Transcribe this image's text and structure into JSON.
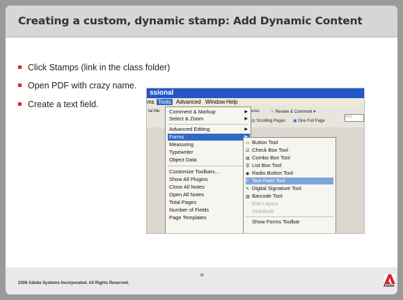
{
  "slide": {
    "title": "Creating a custom, dynamic stamp: Add Dynamic Content",
    "bullets": [
      "Click Stamps  (link in the class folder)",
      "Open PDF with crazy name.",
      "Create a text field."
    ],
    "footer": "2006 Adobe Systems Incorporated.  All Rights Reserved.",
    "page_number": "28",
    "logo_text": "Adobe"
  },
  "screenshot": {
    "window_title": "ssional",
    "menubar": [
      "ms",
      "Tools",
      "Advanced",
      "Window",
      "Help"
    ],
    "toolbar": {
      "item1": "tal Me",
      "item2": "ures",
      "review": "Review & Comment",
      "scrolling": "Scrolling Pages",
      "one_full": "One Full Page",
      "find_placeholder": "Find"
    },
    "tools_menu": [
      {
        "label": "Comment & Markup",
        "submenu": true
      },
      {
        "label": "Select & Zoom",
        "submenu": true
      },
      {
        "label": "Advanced Editing",
        "submenu": true
      },
      {
        "label": "Forms",
        "submenu": true,
        "selected": true
      },
      {
        "label": "Measuring",
        "submenu": true
      },
      {
        "label": "Typewriter",
        "submenu": true
      },
      {
        "label": "Object Data",
        "submenu": true
      },
      {
        "label": "Customize Toolbars..."
      },
      {
        "label": "Show All Plugins"
      },
      {
        "label": "Close All Notes"
      },
      {
        "label": "Open All Notes"
      },
      {
        "label": "Total Pages"
      },
      {
        "label": "Number of Fields"
      },
      {
        "label": "Page Templates"
      }
    ],
    "forms_submenu": [
      {
        "label": "Button Tool",
        "icon": "button-tool-icon",
        "glyph": "▭"
      },
      {
        "label": "Check Box Tool",
        "icon": "checkbox-tool-icon",
        "glyph": "☑"
      },
      {
        "label": "Combo Box Tool",
        "icon": "combobox-tool-icon",
        "glyph": "▤"
      },
      {
        "label": "List Box Tool",
        "icon": "listbox-tool-icon",
        "glyph": "☰"
      },
      {
        "label": "Radio Button Tool",
        "icon": "radio-tool-icon",
        "glyph": "◉"
      },
      {
        "label": "Text Field Tool",
        "icon": "textfield-tool-icon",
        "glyph": "T",
        "selected": true
      },
      {
        "label": "Digital Signature Tool",
        "icon": "signature-tool-icon",
        "glyph": "✎"
      },
      {
        "label": "Barcode Tool",
        "icon": "barcode-tool-icon",
        "glyph": "▥"
      },
      {
        "label": "Edit Layout",
        "icon": "edit-layout-icon",
        "glyph": "",
        "disabled": true
      },
      {
        "label": "Distribute",
        "icon": "distribute-icon",
        "glyph": "",
        "disabled": true
      },
      {
        "label": "Show Forms Toolbar"
      }
    ],
    "colors": {
      "accent": "#316ac5",
      "titlebar": "#2456c8",
      "bullet": "#d8262c"
    }
  }
}
